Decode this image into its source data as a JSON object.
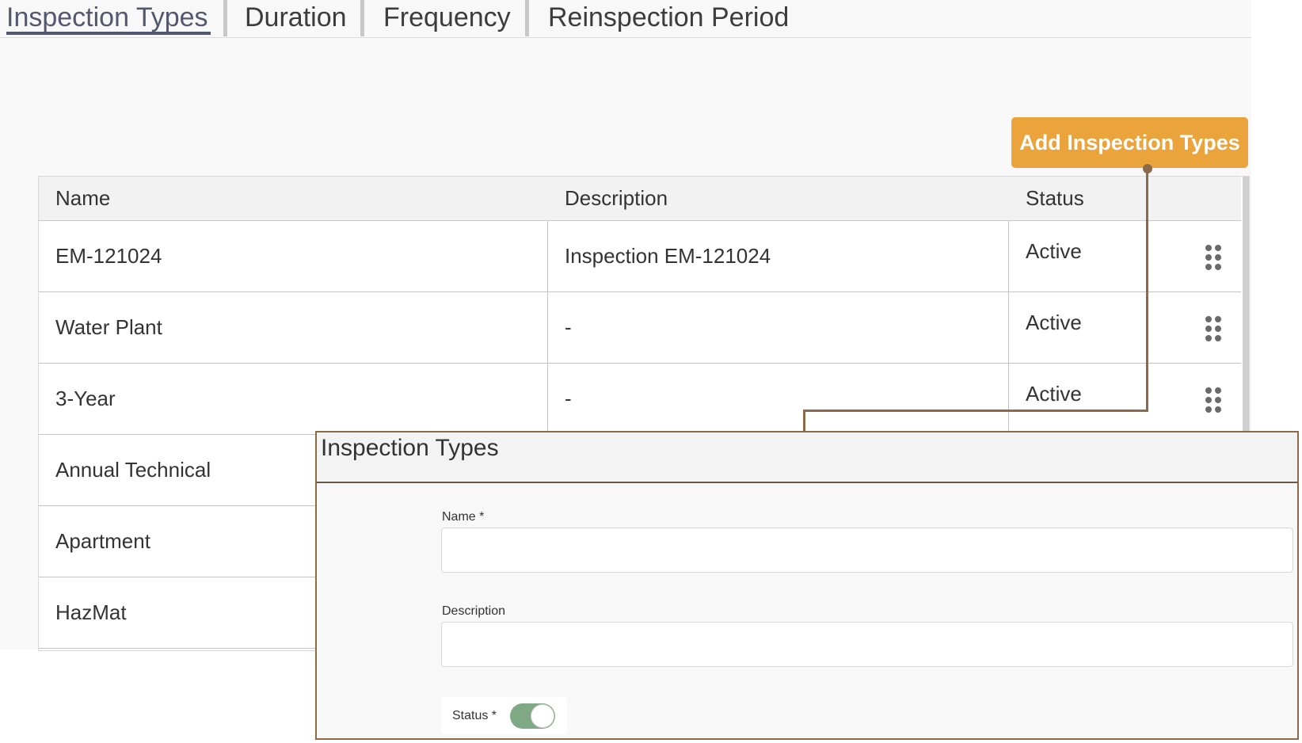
{
  "tabs": [
    {
      "label": "Inspection Types",
      "active": true
    },
    {
      "label": "Duration",
      "active": false
    },
    {
      "label": "Frequency",
      "active": false
    },
    {
      "label": "Reinspection Period",
      "active": false
    }
  ],
  "add_button": {
    "label": "Add Inspection Types"
  },
  "table": {
    "headers": {
      "name": "Name",
      "description": "Description",
      "status": "Status"
    },
    "rows": [
      {
        "name": "EM-121024",
        "description": "Inspection EM-121024",
        "status": "Active"
      },
      {
        "name": "Water Plant",
        "description": "-",
        "status": "Active"
      },
      {
        "name": "3-Year",
        "description": "-",
        "status": "Active"
      },
      {
        "name": "Annual Technical",
        "description": "",
        "status": ""
      },
      {
        "name": "Apartment",
        "description": "",
        "status": ""
      },
      {
        "name": "HazMat",
        "description": "",
        "status": ""
      }
    ]
  },
  "dialog": {
    "title": "Inspection Types",
    "name_label": "Name *",
    "name_value": "",
    "description_label": "Description",
    "description_value": "",
    "status_label": "Status *",
    "status_on": true
  },
  "colors": {
    "accent": "#eba33c",
    "tab_active": "#545770",
    "connector": "#8b6a4c",
    "toggle_on": "#7fa884"
  },
  "icons": {
    "row_handle": "drag-handle-icon"
  }
}
